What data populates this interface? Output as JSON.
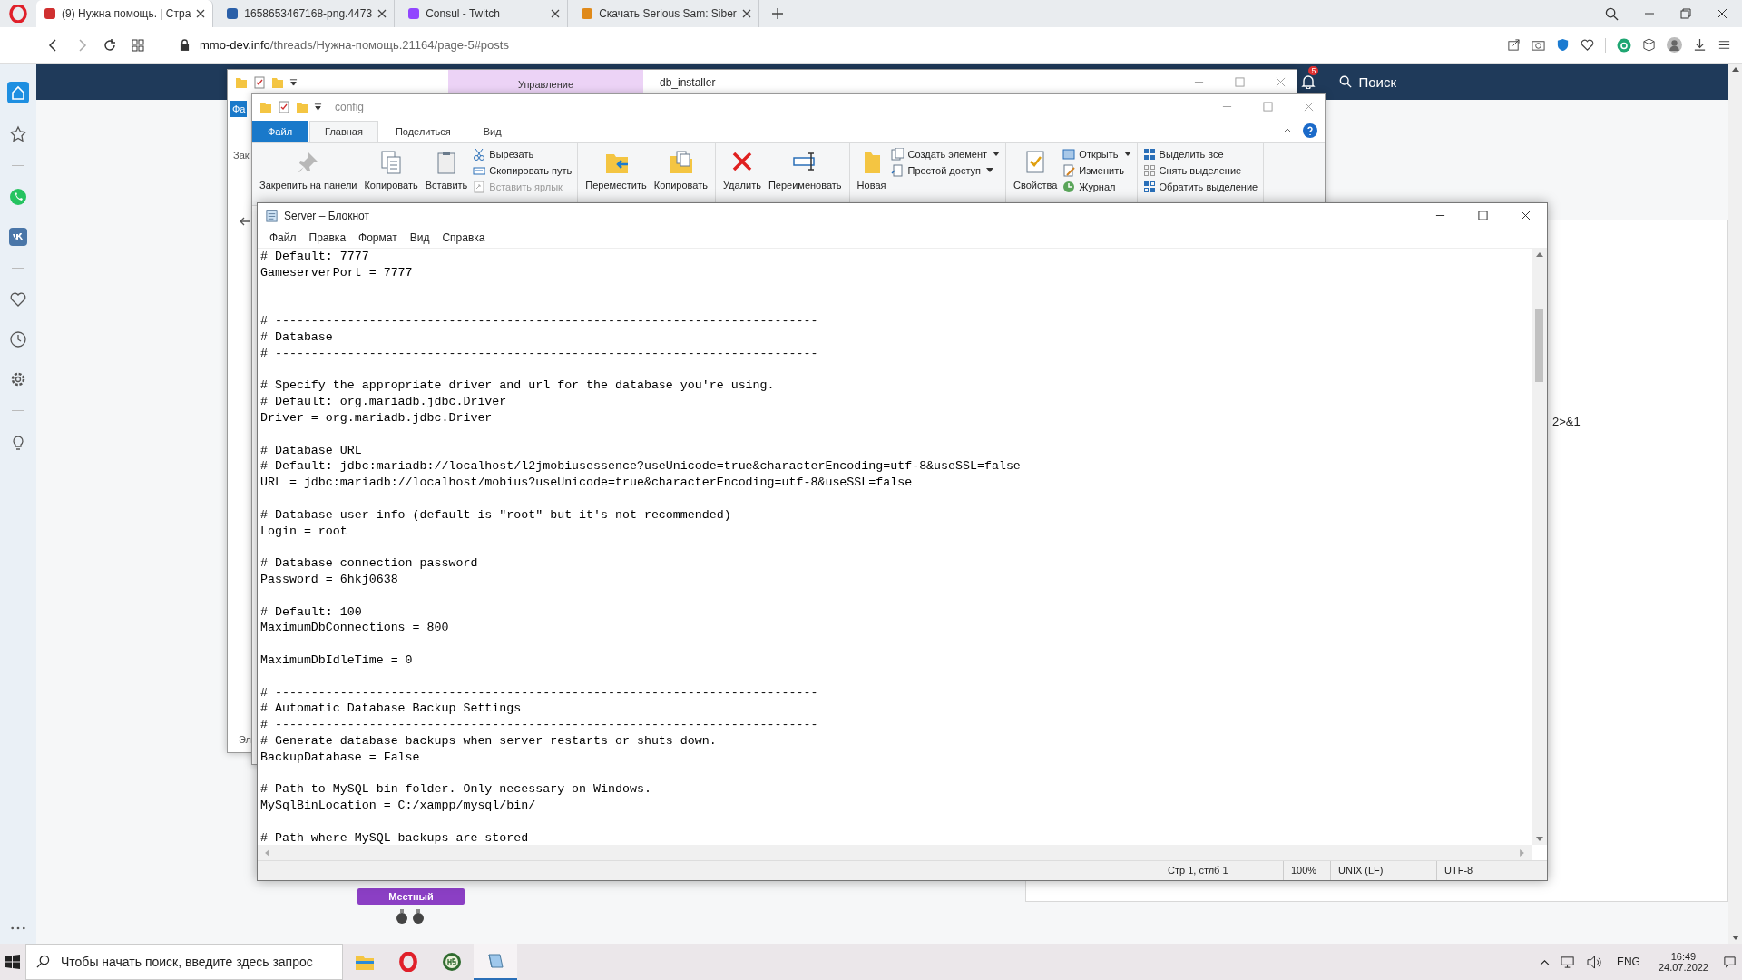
{
  "browser": {
    "tabs": [
      {
        "title": "(9) Нужна помощь. | Стра",
        "selected": true
      },
      {
        "title": "1658653467168-png.4473",
        "selected": false
      },
      {
        "title": "Consul - Twitch",
        "selected": false
      },
      {
        "title": "Скачать Serious Sam: Siber",
        "selected": false
      }
    ],
    "address": {
      "domain": "mmo-dev.info",
      "path": "/threads/Нужна-помощь.21164/page-5#posts"
    }
  },
  "site": {
    "search_label": "Поиск",
    "notification_count": "5",
    "side_text": "2>&1",
    "role_badge": "Местный"
  },
  "explorer_back": {
    "title": "db_installer",
    "context_tab": "Управление",
    "fragments": [
      "Фа",
      "Зак",
      "Эл"
    ]
  },
  "explorer_front": {
    "title": "config",
    "tabs": [
      {
        "label": "Файл",
        "kind": "file",
        "selected": false
      },
      {
        "label": "Главная",
        "kind": "tab",
        "selected": true
      },
      {
        "label": "Поделиться",
        "kind": "tab",
        "selected": false
      },
      {
        "label": "Вид",
        "kind": "tab",
        "selected": false
      }
    ],
    "ribbon": [
      {
        "items": [
          {
            "label": "Закрепить на панели",
            "kind": "large",
            "disabled": false,
            "dropdown": false
          },
          {
            "label": "Копировать",
            "kind": "large",
            "disabled": false,
            "dropdown": false
          },
          {
            "label": "Вставить",
            "kind": "large",
            "disabled": false,
            "dropdown": false
          },
          {
            "label": "Вырезать",
            "kind": "small",
            "disabled": false,
            "dropdown": false
          },
          {
            "label": "Скопировать путь",
            "kind": "small",
            "disabled": false,
            "dropdown": false
          },
          {
            "label": "Вставить ярлык",
            "kind": "small",
            "disabled": true,
            "dropdown": false
          }
        ]
      },
      {
        "items": [
          {
            "label": "Переместить",
            "kind": "large",
            "disabled": false,
            "dropdown": false
          },
          {
            "label": "Копировать",
            "kind": "large",
            "disabled": false,
            "dropdown": false
          }
        ]
      },
      {
        "items": [
          {
            "label": "Удалить",
            "kind": "large",
            "disabled": false,
            "dropdown": false
          },
          {
            "label": "Переименовать",
            "kind": "large",
            "disabled": false,
            "dropdown": false
          }
        ]
      },
      {
        "items": [
          {
            "label": "Новая",
            "kind": "large",
            "disabled": false,
            "dropdown": false
          },
          {
            "label": "Создать элемент",
            "kind": "small",
            "disabled": false,
            "dropdown": true
          },
          {
            "label": "Простой доступ",
            "kind": "small",
            "disabled": false,
            "dropdown": true
          }
        ]
      },
      {
        "items": [
          {
            "label": "Свойства",
            "kind": "large",
            "disabled": false,
            "dropdown": false
          },
          {
            "label": "Открыть",
            "kind": "small",
            "disabled": false,
            "dropdown": true
          },
          {
            "label": "Изменить",
            "kind": "small",
            "disabled": false,
            "dropdown": false
          },
          {
            "label": "Журнал",
            "kind": "small",
            "disabled": false,
            "dropdown": false
          }
        ]
      },
      {
        "items": [
          {
            "label": "Выделить все",
            "kind": "small",
            "disabled": false,
            "dropdown": false
          },
          {
            "label": "Снять выделение",
            "kind": "small",
            "disabled": false,
            "dropdown": false
          },
          {
            "label": "Обратить выделение",
            "kind": "small",
            "disabled": false,
            "dropdown": false
          }
        ]
      }
    ]
  },
  "notepad": {
    "title": "Server – Блокнот",
    "menu": [
      "Файл",
      "Правка",
      "Формат",
      "Вид",
      "Справка"
    ],
    "lines": [
      {
        "kind": "text",
        "text": "# Default: 7777"
      },
      {
        "kind": "text",
        "text": "GameserverPort = 7777"
      },
      {
        "kind": "blank"
      },
      {
        "kind": "blank"
      },
      {
        "kind": "text",
        "text": "# ---------------------------------------------------------------------------"
      },
      {
        "kind": "text",
        "text": "# Database"
      },
      {
        "kind": "text",
        "text": "# ---------------------------------------------------------------------------"
      },
      {
        "kind": "blank"
      },
      {
        "kind": "text",
        "text": "# Specify the appropriate driver and url for the database you're using."
      },
      {
        "kind": "text",
        "text": "# Default: org.mariadb.jdbc.Driver"
      },
      {
        "kind": "text",
        "text": "Driver = org.mariadb.jdbc.Driver"
      },
      {
        "kind": "blank"
      },
      {
        "kind": "text",
        "text": "# Database URL"
      },
      {
        "kind": "text",
        "text": "# Default: jdbc:mariadb://localhost/l2jmobiusessence?useUnicode=true&characterEncoding=utf-8&useSSL=false"
      },
      {
        "kind": "text",
        "text": "URL = jdbc:mariadb://localhost/mobius?useUnicode=true&characterEncoding=utf-8&useSSL=false"
      },
      {
        "kind": "blank"
      },
      {
        "kind": "text",
        "text": "# Database user info (default is \"root\" but it's not recommended)"
      },
      {
        "kind": "text",
        "text": "Login = root"
      },
      {
        "kind": "blank"
      },
      {
        "kind": "text",
        "text": "# Database connection password"
      },
      {
        "kind": "text",
        "text": "Password = 6hkj0638"
      },
      {
        "kind": "blank"
      },
      {
        "kind": "text",
        "text": "# Default: 100"
      },
      {
        "kind": "text",
        "text": "MaximumDbConnections = 800"
      },
      {
        "kind": "blank"
      },
      {
        "kind": "text",
        "text": "MaximumDbIdleTime = 0"
      },
      {
        "kind": "blank"
      },
      {
        "kind": "text",
        "text": "# ---------------------------------------------------------------------------"
      },
      {
        "kind": "text",
        "text": "# Automatic Database Backup Settings"
      },
      {
        "kind": "text",
        "text": "# ---------------------------------------------------------------------------"
      },
      {
        "kind": "text",
        "text": "# Generate database backups when server restarts or shuts down."
      },
      {
        "kind": "text",
        "text": "BackupDatabase = False"
      },
      {
        "kind": "blank"
      },
      {
        "kind": "text",
        "text": "# Path to MySQL bin folder. Only necessary on Windows."
      },
      {
        "kind": "text",
        "text": "MySqlBinLocation = C:/xampp/mysql/bin/"
      },
      {
        "kind": "blank"
      },
      {
        "kind": "text",
        "text": "# Path where MySQL backups are stored"
      }
    ],
    "status": {
      "position": "Стр 1, стлб 1",
      "zoom": "100%",
      "line_ending": "UNIX (LF)",
      "encoding": "UTF-8"
    }
  },
  "taskbar": {
    "search_placeholder": "Чтобы начать поиск, введите здесь запрос",
    "language": "ENG",
    "time": "16:49",
    "date": "24.07.2022"
  }
}
